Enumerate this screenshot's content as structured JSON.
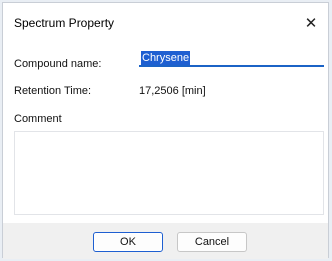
{
  "dialog": {
    "title": "Spectrum Property",
    "close_icon": "close-icon",
    "close_glyph": "✕"
  },
  "form": {
    "compound_label": "Compound name:",
    "compound_value": "Chrysene",
    "retention_label": "Retention Time:",
    "retention_value": "17,2506 [min]",
    "comment_label": "Comment",
    "comment_value": ""
  },
  "buttons": {
    "ok_label": "OK",
    "cancel_label": "Cancel"
  },
  "colors": {
    "accent": "#1e5fd1",
    "background": "#f0f0f0"
  }
}
